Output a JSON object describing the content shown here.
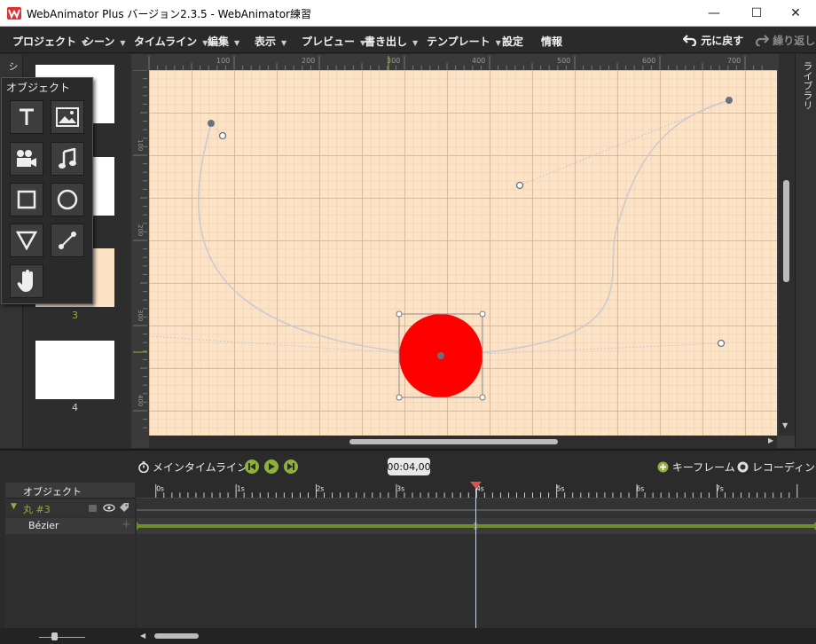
{
  "window": {
    "title": "WebAnimator Plus バージョン2.3.5 - WebAnimator練習",
    "minimize": "—",
    "maximize": "☐",
    "close": "✕"
  },
  "menu": {
    "items": [
      {
        "label": "プロジェクト",
        "has_arrow": true
      },
      {
        "label": "シーン",
        "has_arrow": true
      },
      {
        "label": "タイムライン",
        "has_arrow": true
      },
      {
        "label": "編集",
        "has_arrow": true
      },
      {
        "label": "表示",
        "has_arrow": true
      },
      {
        "label": "プレビュー",
        "has_arrow": true
      },
      {
        "label": "書き出し",
        "has_arrow": true
      },
      {
        "label": "テンプレート",
        "has_arrow": true
      },
      {
        "label": "設定",
        "has_arrow": false
      },
      {
        "label": "情報",
        "has_arrow": false
      }
    ],
    "undo_label": "元に戻す",
    "redo_label": "繰り返し"
  },
  "left_strip": {
    "label": "シ"
  },
  "scenes": {
    "labels": [
      "",
      "",
      "3",
      "4"
    ]
  },
  "palette": {
    "title": "オブジェクト",
    "tools": [
      {
        "name": "text-tool",
        "icon": "text-icon"
      },
      {
        "name": "image-tool",
        "icon": "image-icon"
      },
      {
        "name": "video-tool",
        "icon": "video-camera-icon"
      },
      {
        "name": "audio-tool",
        "icon": "music-note-icon"
      },
      {
        "name": "rectangle-tool",
        "icon": "square-icon"
      },
      {
        "name": "circle-tool",
        "icon": "circle-icon"
      },
      {
        "name": "triangle-tool",
        "icon": "triangle-icon"
      },
      {
        "name": "bezier-tool",
        "icon": "bezier-icon"
      },
      {
        "name": "hand-tool",
        "icon": "hand-icon"
      }
    ]
  },
  "ruler": {
    "top_labels": [
      "100",
      "200",
      "300",
      "400",
      "500",
      "600",
      "700"
    ],
    "left_labels": [
      "100",
      "200",
      "300",
      "400"
    ]
  },
  "library": {
    "label": "ライブラリ"
  },
  "timeline": {
    "main_timeline_label": "メインタイムライン",
    "time": "00:04,00",
    "keyframe_label": "キーフレーム",
    "recording_label": "レコーディング",
    "objects_header": "オブジェクト",
    "object_name": "丸 #3",
    "track_name": "Bézier",
    "seconds": [
      "0s",
      "1s",
      "2s",
      "3s",
      "4s",
      "5s",
      "6s",
      "7s"
    ],
    "playhead_seconds": 4
  },
  "colors": {
    "accent_green": "#8fb13a",
    "stage_bg": "#fde3c6",
    "circle_red": "#ff0000",
    "playhead_red": "#e05050"
  }
}
